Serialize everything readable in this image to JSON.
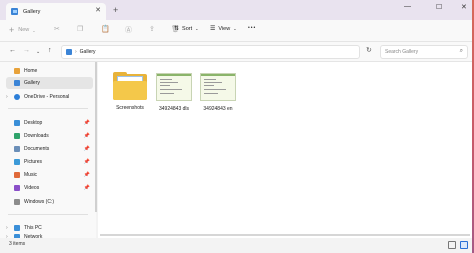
{
  "tab": {
    "title": "Gallery",
    "close": "✕",
    "new": "+"
  },
  "window_controls": {
    "minimize": "—",
    "maximize": "☐",
    "close": "✕"
  },
  "toolbar": {
    "new_label": "New",
    "sort_label": "Sort",
    "view_label": "View",
    "more": "•••"
  },
  "address": {
    "path": "Gallery",
    "chevron": "›"
  },
  "search": {
    "placeholder": "Search Gallery"
  },
  "sidebar": {
    "items": [
      {
        "label": "Home"
      },
      {
        "label": "Gallery"
      },
      {
        "label": "OneDrive - Personal"
      },
      {
        "label": "Desktop"
      },
      {
        "label": "Downloads"
      },
      {
        "label": "Documents"
      },
      {
        "label": "Pictures"
      },
      {
        "label": "Music"
      },
      {
        "label": "Videos"
      },
      {
        "label": "Windows (C:)"
      },
      {
        "label": "This PC"
      },
      {
        "label": "Network"
      }
    ]
  },
  "files": [
    {
      "name": "Screenshots",
      "type": "folder"
    },
    {
      "name": "34924843 dls",
      "type": "image"
    },
    {
      "name": "34924843 en",
      "type": "image"
    }
  ],
  "status": {
    "item_count": "3 items"
  }
}
